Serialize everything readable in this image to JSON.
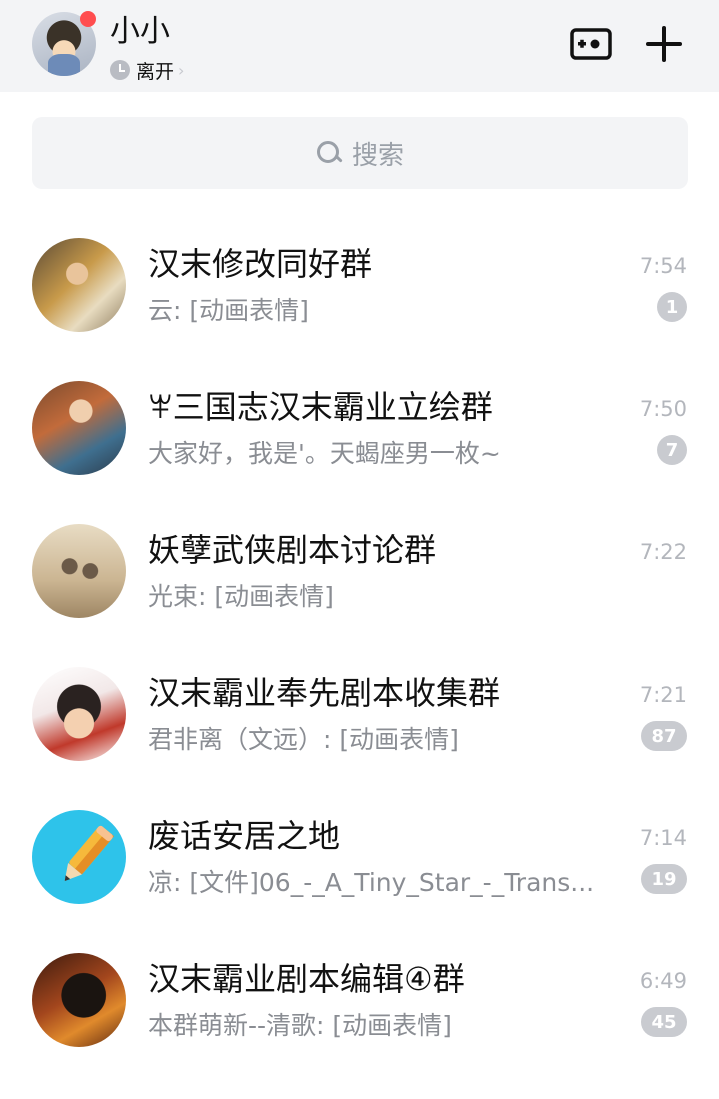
{
  "header": {
    "username": "小小",
    "status": "离开",
    "status_chevron": "›"
  },
  "search": {
    "placeholder": "搜索"
  },
  "chats": [
    {
      "title": "汉末修改同好群",
      "preview": "云: [动画表情]",
      "time": "7:54",
      "unread": "1"
    },
    {
      "title": "ꕽ三国志汉末霸业立绘群",
      "preview": "大家好，我是'。天蝎座男一枚~",
      "time": "7:50",
      "unread": "7"
    },
    {
      "title": "妖孽武侠剧本讨论群",
      "preview": "光束: [动画表情]",
      "time": "7:22",
      "unread": ""
    },
    {
      "title": "汉末霸业奉先剧本收集群",
      "preview": "君非离（文远）: [动画表情]",
      "time": "7:21",
      "unread": "87"
    },
    {
      "title": "废话安居之地",
      "preview": "凉: [文件]06_-_A_Tiny_Star_-_Trans...",
      "time": "7:14",
      "unread": "19"
    },
    {
      "title": "汉末霸业剧本编辑④群",
      "preview": "本群萌新--清歌: [动画表情]",
      "time": "6:49",
      "unread": "45"
    }
  ],
  "colors": {
    "header_bg": "#f3f4f6",
    "notification_dot": "#ff4d4f",
    "badge_bg": "#c9cbd0",
    "secondary_text": "#8a8d93"
  }
}
